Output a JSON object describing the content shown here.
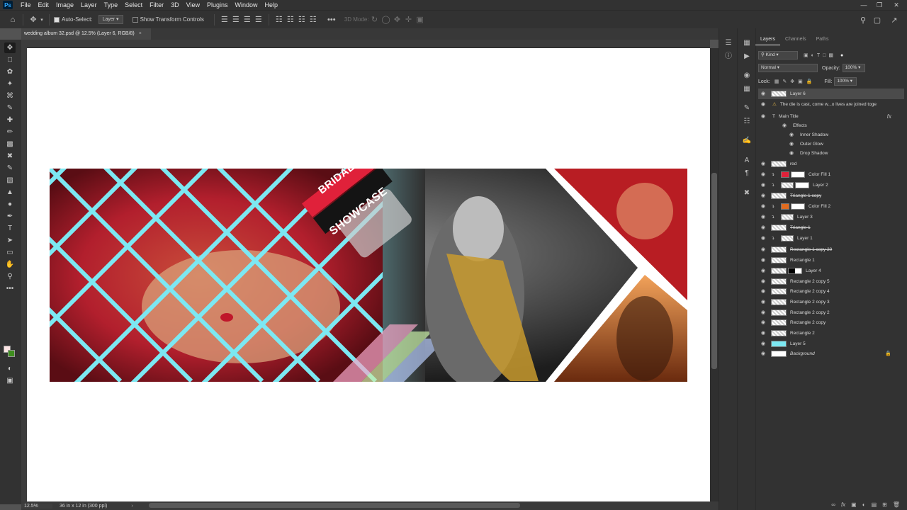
{
  "app": {
    "logo": "Ps"
  },
  "menu": [
    "File",
    "Edit",
    "Image",
    "Layer",
    "Type",
    "Select",
    "Filter",
    "3D",
    "View",
    "Plugins",
    "Window",
    "Help"
  ],
  "options": {
    "auto_select_label": "Auto-Select:",
    "auto_select_value": "Layer",
    "transform_label": "Show Transform Controls",
    "mode_3d_label": "3D Mode:"
  },
  "document": {
    "tab_title": "wedding album 32.psd @ 12.5% (Layer 6, RGB/8)",
    "zoom": "12.5%",
    "doc_info": "36 in x 12 in (300 ppi)"
  },
  "artwork": {
    "banner_line1": "BRIDAL",
    "banner_line2": "SHOWCASE"
  },
  "layers_panel": {
    "tabs": [
      "Layers",
      "Channels",
      "Paths"
    ],
    "filter_kind": "Kind",
    "blend_mode": "Normal",
    "opacity_label": "Opacity:",
    "opacity_value": "100%",
    "lock_label": "Lock:",
    "fill_label": "Fill:",
    "fill_value": "100%",
    "layers": [
      {
        "name": "Layer 6"
      },
      {
        "name": "The die is cast, come w...o lives are joined toge"
      },
      {
        "name": "Main Title"
      },
      {
        "name": "Effects"
      },
      {
        "name": "Inner Shadow"
      },
      {
        "name": "Outer Glow"
      },
      {
        "name": "Drop Shadow"
      },
      {
        "name": "red"
      },
      {
        "name": "Color Fill 1"
      },
      {
        "name": "Layer 2"
      },
      {
        "name": "Triangle 1 copy"
      },
      {
        "name": "Color Fill 2"
      },
      {
        "name": "Layer 3"
      },
      {
        "name": "Triangle 1"
      },
      {
        "name": "Layer 1"
      },
      {
        "name": "Rectangle 1 copy 20"
      },
      {
        "name": "Rectangle 1"
      },
      {
        "name": "Layer 4"
      },
      {
        "name": "Rectangle 2 copy 5"
      },
      {
        "name": "Rectangle 2 copy 4"
      },
      {
        "name": "Rectangle 2 copy 3"
      },
      {
        "name": "Rectangle 2 copy 2"
      },
      {
        "name": "Rectangle 2 copy"
      },
      {
        "name": "Rectangle 2"
      },
      {
        "name": "Layer 5"
      },
      {
        "name": "Background"
      }
    ]
  },
  "colors": {
    "accent_red": "#e0213a",
    "cyan": "#6fe6f0",
    "panel": "#323232"
  }
}
